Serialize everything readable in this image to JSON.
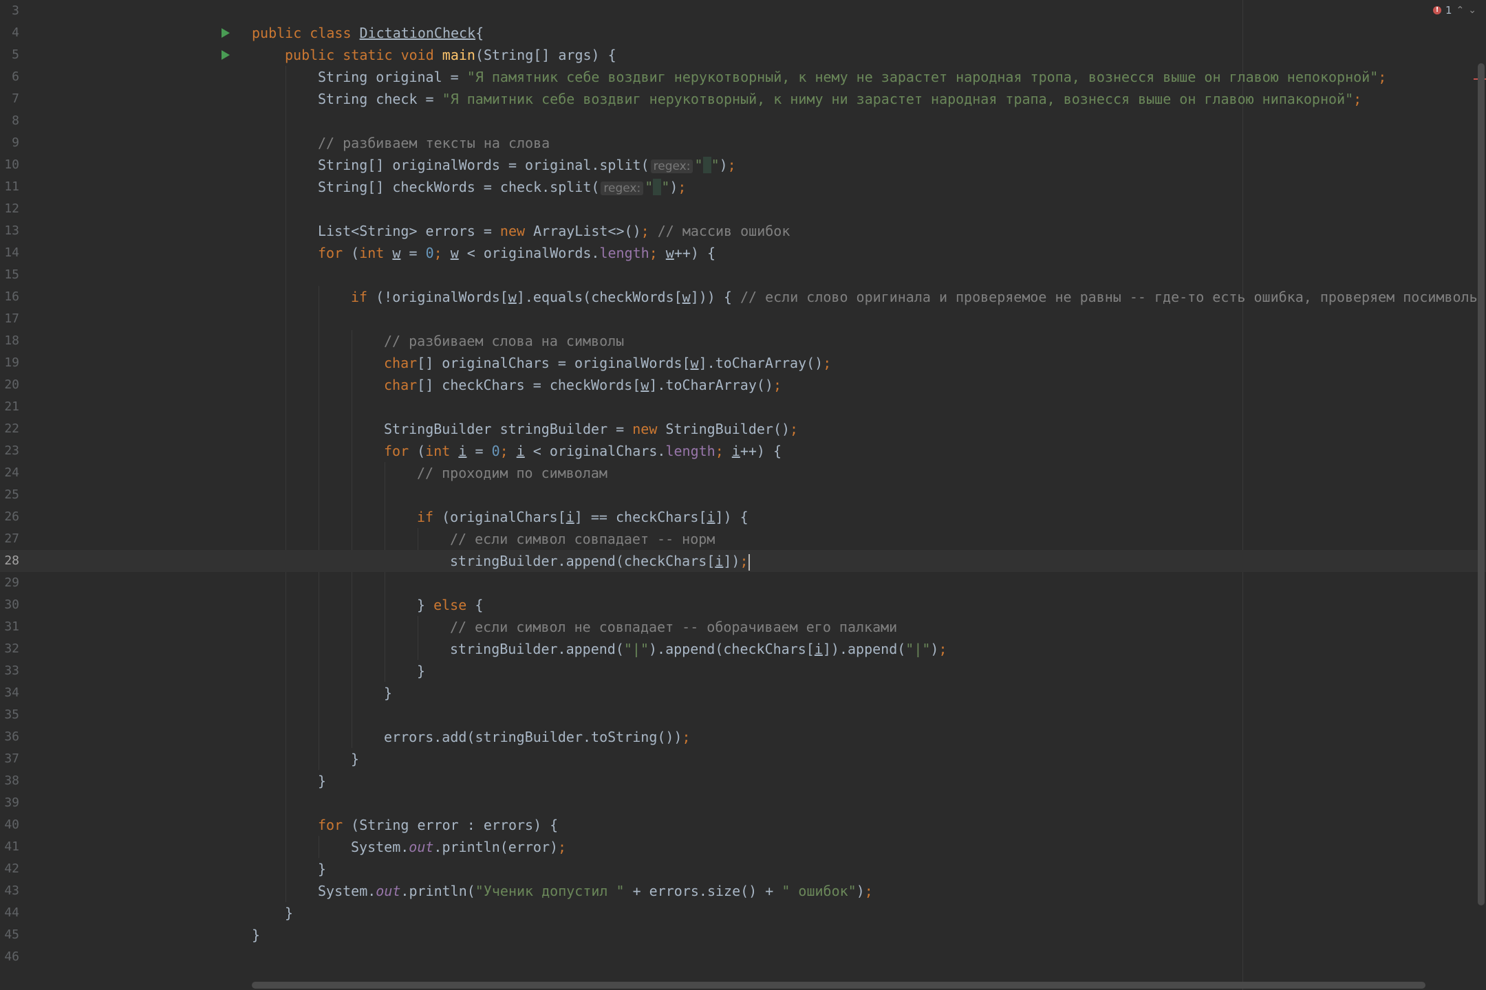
{
  "editor": {
    "file_class": "DictationCheck",
    "current_line": 28,
    "error_count": "1",
    "error_mark": "!",
    "nav_up": "⌃",
    "nav_down": "⌄"
  },
  "lines": [
    {
      "n": 3,
      "indent": 0,
      "tokens": []
    },
    {
      "n": 4,
      "indent": 0,
      "run": true,
      "tokens": [
        [
          "kw",
          "public class "
        ],
        [
          "ul",
          "DictationCheck"
        ],
        [
          "",
          "{"
        ]
      ]
    },
    {
      "n": 5,
      "indent": 1,
      "run": true,
      "tokens": [
        [
          "kw",
          "public static void "
        ],
        [
          "mth",
          "main"
        ],
        [
          "",
          "(String[] args) {"
        ]
      ]
    },
    {
      "n": 6,
      "indent": 2,
      "tokens": [
        [
          "",
          "String original = "
        ],
        [
          "str",
          "\"Я памятник себе воздвиг нерукотворный, к нему не зарастет народная тропа, вознесся выше он главою непокорной\""
        ],
        [
          "kw",
          ";"
        ]
      ]
    },
    {
      "n": 7,
      "indent": 2,
      "tokens": [
        [
          "",
          "String check = "
        ],
        [
          "str",
          "\"Я памитник себе воздвиг нерукотворный, к ниму ни зарастет народная трапа, вознесся выше он главою нипакорной\""
        ],
        [
          "kw",
          ";"
        ]
      ]
    },
    {
      "n": 8,
      "indent": 0,
      "tokens": []
    },
    {
      "n": 9,
      "indent": 2,
      "tokens": [
        [
          "cmt",
          "// разбиваем тексты на слова"
        ]
      ]
    },
    {
      "n": 10,
      "indent": 2,
      "tokens": [
        [
          "",
          "String[] originalWords = original.split("
        ],
        [
          "hint",
          "regex:"
        ],
        [
          "str",
          "\""
        ],
        [
          "ws",
          " "
        ],
        [
          "str",
          "\""
        ],
        [
          "",
          ")"
        ],
        [
          "kw",
          ";"
        ]
      ]
    },
    {
      "n": 11,
      "indent": 2,
      "tokens": [
        [
          "",
          "String[] checkWords = check.split("
        ],
        [
          "hint",
          "regex:"
        ],
        [
          "str",
          "\""
        ],
        [
          "ws",
          " "
        ],
        [
          "str",
          "\""
        ],
        [
          "",
          ")"
        ],
        [
          "kw",
          ";"
        ]
      ]
    },
    {
      "n": 12,
      "indent": 0,
      "tokens": []
    },
    {
      "n": 13,
      "indent": 2,
      "tokens": [
        [
          "",
          "List<String> errors = "
        ],
        [
          "kw",
          "new "
        ],
        [
          "",
          "ArrayList<>()"
        ],
        [
          "kw",
          "; "
        ],
        [
          "cmt",
          "// массив ошибок"
        ]
      ]
    },
    {
      "n": 14,
      "indent": 2,
      "tokens": [
        [
          "kw",
          "for "
        ],
        [
          "",
          "("
        ],
        [
          "kw",
          "int "
        ],
        [
          "ul",
          "w"
        ],
        [
          "",
          " = "
        ],
        [
          "num",
          "0"
        ],
        [
          "kw",
          "; "
        ],
        [
          "ul",
          "w"
        ],
        [
          "",
          " < originalWords."
        ],
        [
          "fld",
          "length"
        ],
        [
          "kw",
          "; "
        ],
        [
          "ul",
          "w"
        ],
        [
          "",
          "++) {"
        ]
      ]
    },
    {
      "n": 15,
      "indent": 0,
      "tokens": []
    },
    {
      "n": 16,
      "indent": 3,
      "tokens": [
        [
          "kw",
          "if "
        ],
        [
          "",
          "(!originalWords["
        ],
        [
          "ul",
          "w"
        ],
        [
          "",
          "].equals(checkWords["
        ],
        [
          "ul",
          "w"
        ],
        [
          "",
          "])) { "
        ],
        [
          "cmt",
          "// если слово оригинала и проверяемое не равны -- где-то есть ошибка, проверяем посимвольно"
        ]
      ]
    },
    {
      "n": 17,
      "indent": 0,
      "tokens": []
    },
    {
      "n": 18,
      "indent": 4,
      "tokens": [
        [
          "cmt",
          "// разбиваем слова на символы"
        ]
      ]
    },
    {
      "n": 19,
      "indent": 4,
      "tokens": [
        [
          "kw",
          "char"
        ],
        [
          "",
          "[] originalChars = originalWords["
        ],
        [
          "ul",
          "w"
        ],
        [
          "",
          "].toCharArray()"
        ],
        [
          "kw",
          ";"
        ]
      ]
    },
    {
      "n": 20,
      "indent": 4,
      "tokens": [
        [
          "kw",
          "char"
        ],
        [
          "",
          "[] checkChars = checkWords["
        ],
        [
          "ul",
          "w"
        ],
        [
          "",
          "].toCharArray()"
        ],
        [
          "kw",
          ";"
        ]
      ]
    },
    {
      "n": 21,
      "indent": 0,
      "tokens": []
    },
    {
      "n": 22,
      "indent": 4,
      "tokens": [
        [
          "",
          "StringBuilder stringBuilder = "
        ],
        [
          "kw",
          "new "
        ],
        [
          "",
          "StringBuilder()"
        ],
        [
          "kw",
          ";"
        ]
      ]
    },
    {
      "n": 23,
      "indent": 4,
      "tokens": [
        [
          "kw",
          "for "
        ],
        [
          "",
          "("
        ],
        [
          "kw",
          "int "
        ],
        [
          "ul",
          "i"
        ],
        [
          "",
          " = "
        ],
        [
          "num",
          "0"
        ],
        [
          "kw",
          "; "
        ],
        [
          "ul",
          "i"
        ],
        [
          "",
          " < originalChars."
        ],
        [
          "fld",
          "length"
        ],
        [
          "kw",
          "; "
        ],
        [
          "ul",
          "i"
        ],
        [
          "",
          "++) {"
        ]
      ]
    },
    {
      "n": 24,
      "indent": 5,
      "tokens": [
        [
          "cmt",
          "// проходим по символам"
        ]
      ]
    },
    {
      "n": 25,
      "indent": 0,
      "tokens": []
    },
    {
      "n": 26,
      "indent": 5,
      "tokens": [
        [
          "kw",
          "if "
        ],
        [
          "",
          "(originalChars["
        ],
        [
          "ul",
          "i"
        ],
        [
          "",
          "] == checkChars["
        ],
        [
          "ul",
          "i"
        ],
        [
          "",
          "]) {"
        ]
      ]
    },
    {
      "n": 27,
      "indent": 6,
      "tokens": [
        [
          "cmt",
          "// если символ совпадает -- норм"
        ]
      ]
    },
    {
      "n": 28,
      "indent": 6,
      "caret": true,
      "tokens": [
        [
          "",
          "stringBuilder.append(checkChars["
        ],
        [
          "ul",
          "i"
        ],
        [
          "",
          "])"
        ],
        [
          "kw",
          ";"
        ]
      ]
    },
    {
      "n": 29,
      "indent": 0,
      "tokens": []
    },
    {
      "n": 30,
      "indent": 5,
      "tokens": [
        [
          "",
          "} "
        ],
        [
          "kw",
          "else "
        ],
        [
          "",
          "{"
        ]
      ]
    },
    {
      "n": 31,
      "indent": 6,
      "tokens": [
        [
          "cmt",
          "// если символ не совпадает -- оборачиваем его палками"
        ]
      ]
    },
    {
      "n": 32,
      "indent": 6,
      "tokens": [
        [
          "",
          "stringBuilder.append("
        ],
        [
          "str",
          "\"|\""
        ],
        [
          "",
          ").append(checkChars["
        ],
        [
          "ul",
          "i"
        ],
        [
          "",
          "]).append("
        ],
        [
          "str",
          "\"|\""
        ],
        [
          "",
          ")"
        ],
        [
          "kw",
          ";"
        ]
      ]
    },
    {
      "n": 33,
      "indent": 5,
      "tokens": [
        [
          "",
          "}"
        ]
      ]
    },
    {
      "n": 34,
      "indent": 4,
      "tokens": [
        [
          "",
          "}"
        ]
      ]
    },
    {
      "n": 35,
      "indent": 0,
      "tokens": []
    },
    {
      "n": 36,
      "indent": 4,
      "tokens": [
        [
          "",
          "errors.add(stringBuilder.toString())"
        ],
        [
          "kw",
          ";"
        ]
      ]
    },
    {
      "n": 37,
      "indent": 3,
      "tokens": [
        [
          "",
          "}"
        ]
      ]
    },
    {
      "n": 38,
      "indent": 2,
      "tokens": [
        [
          "",
          "}"
        ]
      ]
    },
    {
      "n": 39,
      "indent": 0,
      "tokens": []
    },
    {
      "n": 40,
      "indent": 2,
      "tokens": [
        [
          "kw",
          "for "
        ],
        [
          "",
          "(String error : errors) {"
        ]
      ]
    },
    {
      "n": 41,
      "indent": 3,
      "tokens": [
        [
          "",
          "System."
        ],
        [
          "sfld",
          "out"
        ],
        [
          "",
          ".println(error)"
        ],
        [
          "kw",
          ";"
        ]
      ]
    },
    {
      "n": 42,
      "indent": 2,
      "tokens": [
        [
          "",
          "}"
        ]
      ]
    },
    {
      "n": 43,
      "indent": 2,
      "tokens": [
        [
          "",
          "System."
        ],
        [
          "sfld",
          "out"
        ],
        [
          "",
          ".println("
        ],
        [
          "str",
          "\"Ученик допустил \""
        ],
        [
          "",
          " + errors.size() + "
        ],
        [
          "str",
          "\" ошибок\""
        ],
        [
          "",
          ")"
        ],
        [
          "kw",
          ";"
        ]
      ]
    },
    {
      "n": 44,
      "indent": 1,
      "tokens": [
        [
          "",
          "}"
        ]
      ]
    },
    {
      "n": 45,
      "indent": 0,
      "tokens": [
        [
          "",
          "}"
        ]
      ]
    },
    {
      "n": 46,
      "indent": 0,
      "tokens": []
    }
  ]
}
